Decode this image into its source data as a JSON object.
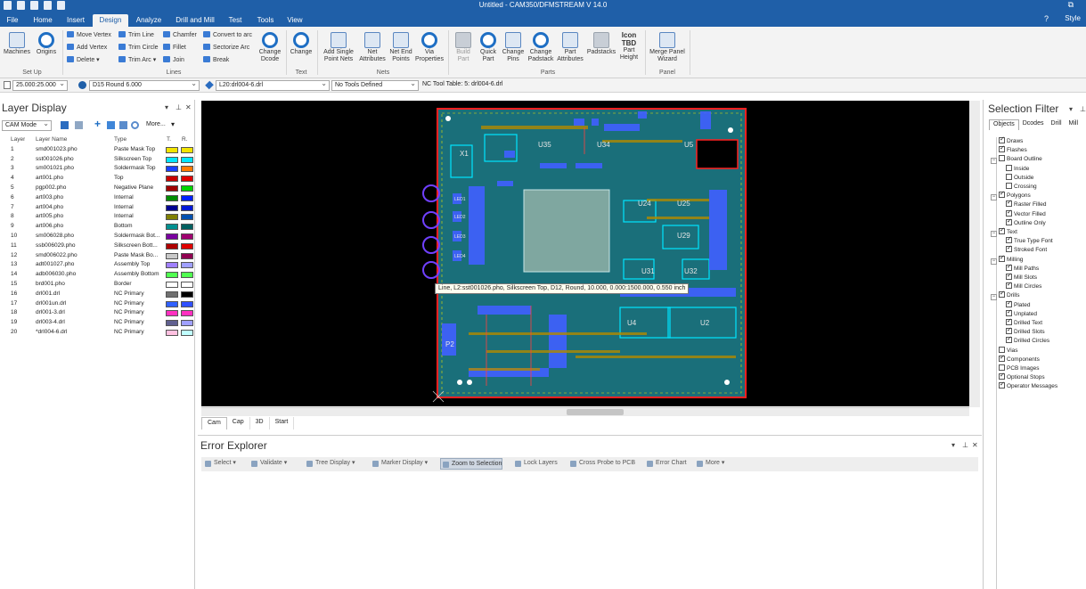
{
  "window": {
    "title": "Untitled - CAM350/DFMSTREAM V 14.0",
    "help": "?",
    "style": "Style"
  },
  "menu": [
    "File",
    "Home",
    "Insert",
    "Design",
    "Analyze",
    "Drill and Mill",
    "Test",
    "Tools",
    "View"
  ],
  "menu_active": "Design",
  "ribbon": {
    "setup": {
      "machines": "Machines",
      "origins": "Origins",
      "group": "Set Up"
    },
    "lines": {
      "move_vertex": "Move Vertex",
      "add_vertex": "Add Vertex",
      "delete": "Delete",
      "trim_line": "Trim Line",
      "trim_circle": "Trim Circle",
      "trim_arc": "Trim Arc",
      "chamfer": "Chamfer",
      "fillet": "Fillet",
      "join": "Join",
      "convert_to_arc": "Convert to arc",
      "sectorize_arc": "Sectorize Arc",
      "break": "Break",
      "change_dcode": "Change Dcode",
      "group": "Lines"
    },
    "text": {
      "change": "Change",
      "group": "Text"
    },
    "nets": {
      "add_single_point_nets": "Add Single Point Nets",
      "net_attributes": "Net Attributes",
      "net_end_points": "Net End Points",
      "via_properties": "Via Properties",
      "group": "Nets"
    },
    "parts": {
      "build_part": "Build Part",
      "quick_part": "Quick Part",
      "change_pins": "Change Pins",
      "change_padstack": "Change Padstack",
      "part_attributes": "Part Attributes",
      "padstacks": "Padstacks",
      "part_height": "Part Height",
      "icon_tbd": "Icon TBD",
      "group": "Parts"
    },
    "panel": {
      "merge_panel_wizard": "Merge Panel Wizard",
      "group": "Panel"
    }
  },
  "toolrow": {
    "grid": "25.000:25.000",
    "dcode": "D15  Round 6.000",
    "layer": "L20:drl004-6.drl",
    "tools": "No Tools Defined",
    "nc_table": "NC Tool Table: 5: drl004-6.drl"
  },
  "layer_display": {
    "title": "Layer Display",
    "mode": "CAM Mode",
    "more": "More...",
    "headers": {
      "layer": "Layer",
      "name": "Layer Name",
      "type": "Type",
      "t": "T.",
      "r": "R."
    },
    "rows": [
      {
        "num": "1",
        "name": "smd001023.pho",
        "type": "Paste Mask Top",
        "c1": "#f2e400",
        "c2": "#f2e400"
      },
      {
        "num": "2",
        "name": "sst001026.pho",
        "type": "Silkscreen Top",
        "c1": "#00e5ff",
        "c2": "#00e5ff"
      },
      {
        "num": "3",
        "name": "sm001021.pho",
        "type": "Soldermask Top",
        "c1": "#1840ff",
        "c2": "#ff7a00"
      },
      {
        "num": "4",
        "name": "art001.pho",
        "type": "Top",
        "c1": "#c80000",
        "c2": "#e00000"
      },
      {
        "num": "5",
        "name": "pgp002.pho",
        "type": "Negative Plane",
        "c1": "#a00000",
        "c2": "#00d400"
      },
      {
        "num": "6",
        "name": "art003.pho",
        "type": "Internal",
        "c1": "#008c00",
        "c2": "#0020ff"
      },
      {
        "num": "7",
        "name": "art004.pho",
        "type": "Internal",
        "c1": "#000090",
        "c2": "#0018d8"
      },
      {
        "num": "8",
        "name": "art005.pho",
        "type": "Internal",
        "c1": "#808000",
        "c2": "#0050b0"
      },
      {
        "num": "9",
        "name": "art006.pho",
        "type": "Bottom",
        "c1": "#009090",
        "c2": "#006060"
      },
      {
        "num": "10",
        "name": "sm006028.pho",
        "type": "Soldermask Bot...",
        "c1": "#7a00a0",
        "c2": "#a00070"
      },
      {
        "num": "11",
        "name": "ssb006029.pho",
        "type": "Silkscreen Bott...",
        "c1": "#b00000",
        "c2": "#e00000"
      },
      {
        "num": "12",
        "name": "smd006022.pho",
        "type": "Paste Mask Bo...",
        "c1": "#c8c8c8",
        "c2": "#900050"
      },
      {
        "num": "13",
        "name": "adt001027.pho",
        "type": "Assembly Top",
        "c1": "#a080ff",
        "c2": "#a0a0ff"
      },
      {
        "num": "14",
        "name": "adb006030.pho",
        "type": "Assembly Bottom",
        "c1": "#50ff50",
        "c2": "#50ff50"
      },
      {
        "num": "15",
        "name": "brd001.pho",
        "type": "Border",
        "c1": "#ffffff",
        "c2": "#ffffff"
      },
      {
        "num": "16",
        "name": "drl001.drl",
        "type": "NC Primary",
        "c1": "#707070",
        "c2": "#000000"
      },
      {
        "num": "17",
        "name": "drl001un.drl",
        "type": "NC Primary",
        "c1": "#3060ff",
        "c2": "#3050ff"
      },
      {
        "num": "18",
        "name": "drl001-3.drl",
        "type": "NC Primary",
        "c1": "#ff30c0",
        "c2": "#ff30c0"
      },
      {
        "num": "19",
        "name": "drl003-4.drl",
        "type": "NC Primary",
        "c1": "#606090",
        "c2": "#a0a0ff"
      },
      {
        "num": "20",
        "name": "*drl004-6.drl",
        "type": "NC Primary",
        "c1": "#ffc0e0",
        "c2": "#c0ffff"
      }
    ]
  },
  "canvas": {
    "tooltip": "Line, L2:sst001026.pho, Silkscreen Top, D12, Round, 10.000, 0.000:1500.000, 0.550 inch",
    "labels": [
      "X1",
      "U35",
      "U34",
      "U5",
      "U24",
      "U25",
      "U29",
      "U31",
      "U32",
      "U4",
      "U2",
      "P2",
      "LED1",
      "LED2",
      "LED3",
      "LED4"
    ],
    "view_tabs": [
      "Cam",
      "Cap",
      "3D",
      "Start"
    ]
  },
  "error_explorer": {
    "title": "Error Explorer",
    "buttons": [
      "Select",
      "Validate",
      "Tree Display",
      "Marker Display",
      "Zoom to Selection",
      "Lock Layers",
      "Cross Probe to PCB",
      "Error Chart",
      "More"
    ]
  },
  "selection_filter": {
    "title": "Selection Filter",
    "tabs": [
      "Objects",
      "Dcodes",
      "Drill",
      "Mill"
    ],
    "items": [
      {
        "label": "Draws",
        "level": 0,
        "checked": true
      },
      {
        "label": "Flashes",
        "level": 0,
        "checked": true
      },
      {
        "label": "Board Outline",
        "level": 0,
        "checked": false,
        "group": true
      },
      {
        "label": "Inside",
        "level": 1,
        "checked": false
      },
      {
        "label": "Outside",
        "level": 1,
        "checked": false
      },
      {
        "label": "Crossing",
        "level": 1,
        "checked": false
      },
      {
        "label": "Polygons",
        "level": 0,
        "checked": true,
        "group": true
      },
      {
        "label": "Raster Filled",
        "level": 1,
        "checked": true
      },
      {
        "label": "Vector Filled",
        "level": 1,
        "checked": true
      },
      {
        "label": "Outline Only",
        "level": 1,
        "checked": true
      },
      {
        "label": "Text",
        "level": 0,
        "checked": true,
        "group": true
      },
      {
        "label": "True Type Font",
        "level": 1,
        "checked": true
      },
      {
        "label": "Stroked Font",
        "level": 1,
        "checked": true
      },
      {
        "label": "Milling",
        "level": 0,
        "checked": true,
        "group": true
      },
      {
        "label": "Mill Paths",
        "level": 1,
        "checked": true
      },
      {
        "label": "Mill Slots",
        "level": 1,
        "checked": true
      },
      {
        "label": "Mill Circles",
        "level": 1,
        "checked": true
      },
      {
        "label": "Drills",
        "level": 0,
        "checked": true,
        "group": true
      },
      {
        "label": "Plated",
        "level": 1,
        "checked": true
      },
      {
        "label": "Unplated",
        "level": 1,
        "checked": true
      },
      {
        "label": "Drilled Text",
        "level": 1,
        "checked": true
      },
      {
        "label": "Drilled Slots",
        "level": 1,
        "checked": true
      },
      {
        "label": "Drilled Circles",
        "level": 1,
        "checked": true
      },
      {
        "label": "Vias",
        "level": 0,
        "checked": false
      },
      {
        "label": "Components",
        "level": 0,
        "checked": true
      },
      {
        "label": "PCB Images",
        "level": 0,
        "checked": false
      },
      {
        "label": "Optional Stops",
        "level": 0,
        "checked": true
      },
      {
        "label": "Operator Messages",
        "level": 0,
        "checked": true
      }
    ]
  }
}
